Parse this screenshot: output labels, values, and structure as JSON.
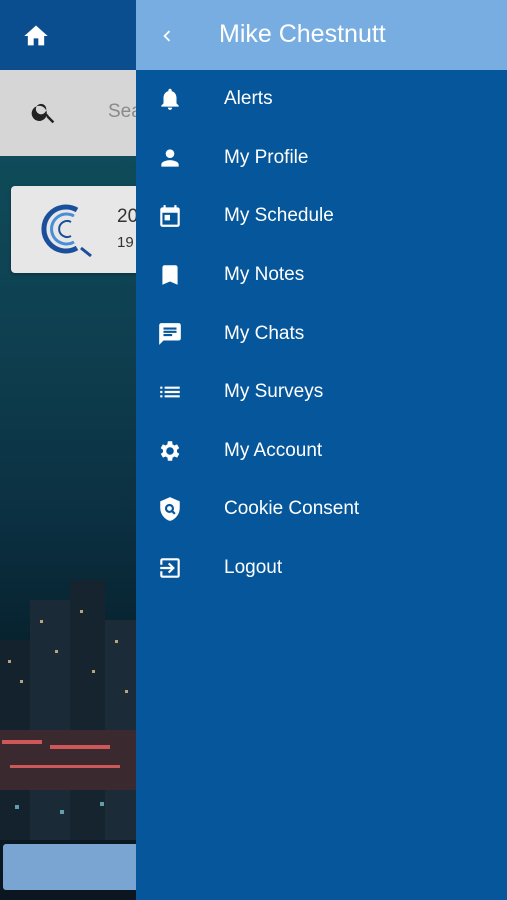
{
  "search": {
    "placeholder_visible": "Sea"
  },
  "card": {
    "line1": "20",
    "line2": "19"
  },
  "drawer": {
    "user_name": "Mike Chestnutt",
    "menu": [
      {
        "label": "Alerts",
        "icon": "bell-icon"
      },
      {
        "label": "My Profile",
        "icon": "person-icon"
      },
      {
        "label": "My Schedule",
        "icon": "calendar-icon"
      },
      {
        "label": "My Notes",
        "icon": "bookmark-icon"
      },
      {
        "label": "My Chats",
        "icon": "chat-icon"
      },
      {
        "label": "My Surveys",
        "icon": "list-icon"
      },
      {
        "label": "My Account",
        "icon": "gear-icon"
      },
      {
        "label": "Cookie Consent",
        "icon": "shield-search-icon"
      },
      {
        "label": "Logout",
        "icon": "logout-icon"
      }
    ]
  },
  "colors": {
    "drawer_bg": "#05569a",
    "drawer_header": "#78ade2",
    "topbar": "#0a4e8f",
    "searchbar": "#d6d6d6"
  }
}
